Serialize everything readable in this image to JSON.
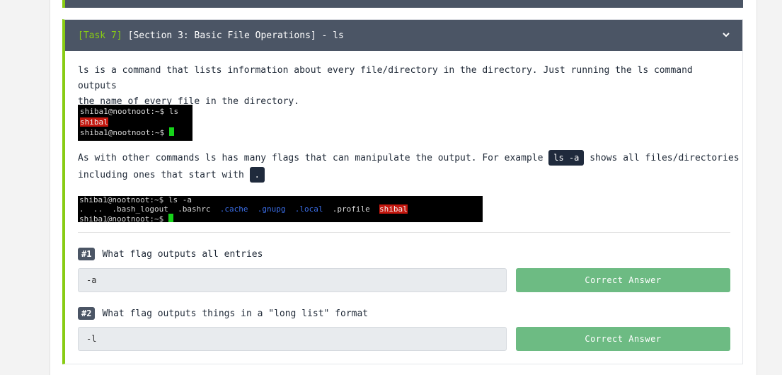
{
  "task": {
    "tag": "[Task 7]",
    "title": "[Section 3: Basic File Operations] - ls"
  },
  "content": {
    "para1_line1": "ls is a command that lists information about every file/directory in the directory. Just running the ls command outputs",
    "para1_line2": "the name of every file in the directory.",
    "para2_line1_prefix": "As with other commands ls has many flags that can manipulate the output.  For example",
    "para2_chip1": "ls -a",
    "para2_line1_suffix": "shows all files/directories",
    "para2_line2_prefix": "including ones that start with",
    "para2_chip2": "."
  },
  "terminal1": {
    "line1": "shiba1@nootnoot:~$ ls",
    "line2": "shibal",
    "line3": "shiba1@nootnoot:~$ "
  },
  "terminal2": {
    "line1": "shiba1@nootnoot:~$ ls -a",
    "entries": [
      ".",
      "..",
      ".bash_logout",
      ".bashrc",
      ".cache",
      ".gnupg",
      ".local",
      ".profile",
      "shibal"
    ],
    "line3": "shiba1@nootnoot:~$ "
  },
  "questions": [
    {
      "number": "#1",
      "text": "What flag outputs all entries",
      "answer": "-a",
      "button_label": "Correct Answer"
    },
    {
      "number": "#2",
      "text": "What flag outputs things in a \"long list\" format",
      "answer": "-l",
      "button_label": "Correct Answer"
    }
  ],
  "colors": {
    "header_bg": "#4b5565",
    "accent_green": "#88cc14",
    "correct_button": "#6dbb83",
    "terminal_highlight": "#c4170e"
  },
  "icons": {
    "collapse": "chevron-down-icon"
  }
}
